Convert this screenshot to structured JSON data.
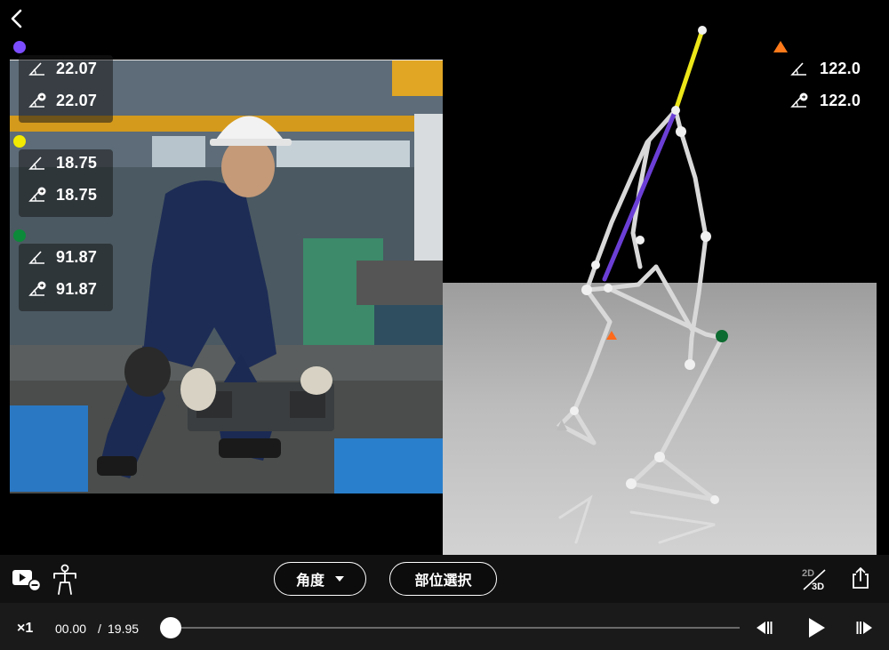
{
  "nav": {
    "back_icon": "chevron-left-icon"
  },
  "left_angles": [
    {
      "color": "#7c4dff",
      "values": [
        "22.07",
        "22.07"
      ]
    },
    {
      "color": "#f2ea00",
      "values": [
        "18.75",
        "18.75"
      ]
    },
    {
      "color": "#0c8a3a",
      "values": [
        "91.87",
        "91.87"
      ]
    }
  ],
  "right_angle": {
    "color": "#ff7a1a",
    "values": [
      "122.0",
      "122.0"
    ]
  },
  "toolbar": {
    "angle_label": "角度",
    "part_select_label": "部位選択",
    "view_toggle": {
      "top": "2D",
      "bottom": "3D"
    }
  },
  "player": {
    "speed": "×1",
    "current_time": "00.00",
    "separator": "/",
    "total_time": "19.95",
    "progress": 0.0
  }
}
